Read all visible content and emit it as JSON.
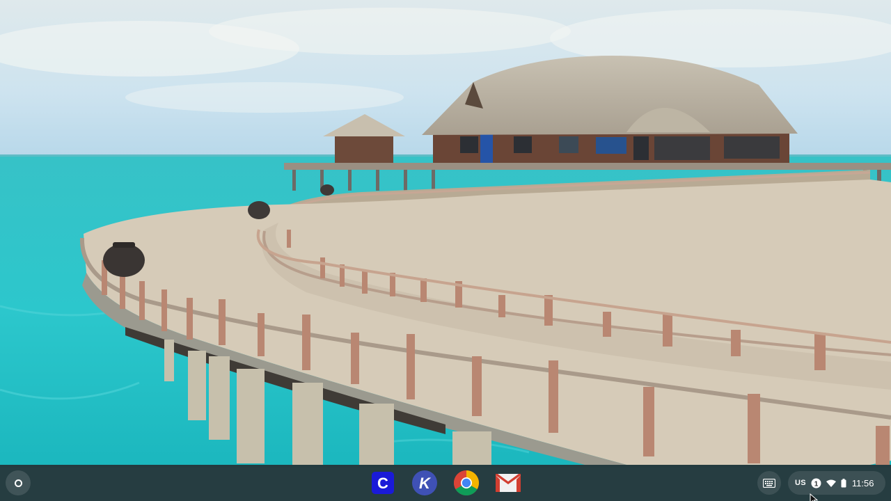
{
  "desktop": {
    "wallpaper": "wallpaper-overwater-villa-boardwalk"
  },
  "shelf": {
    "launcher": {
      "icon": "launcher-circle-icon"
    },
    "pinned_apps": [
      {
        "icon": "c-app-icon",
        "letter": "C",
        "color": "#1a1ad8"
      },
      {
        "icon": "k-app-icon",
        "letter": "K",
        "color": "#3f51b5"
      },
      {
        "icon": "chrome-icon"
      },
      {
        "icon": "gmail-icon"
      }
    ],
    "ime": {
      "icon": "keyboard-icon"
    },
    "status": {
      "input_method": "US",
      "notification_icon": "notification-count-icon",
      "notification_count": "1",
      "wifi_icon": "wifi-icon",
      "battery_icon": "battery-icon",
      "time": "11:56"
    }
  },
  "colors": {
    "shelf_bg": "#262a2d",
    "sea": "#2fc4c9",
    "sky": "#cfe4ee"
  }
}
